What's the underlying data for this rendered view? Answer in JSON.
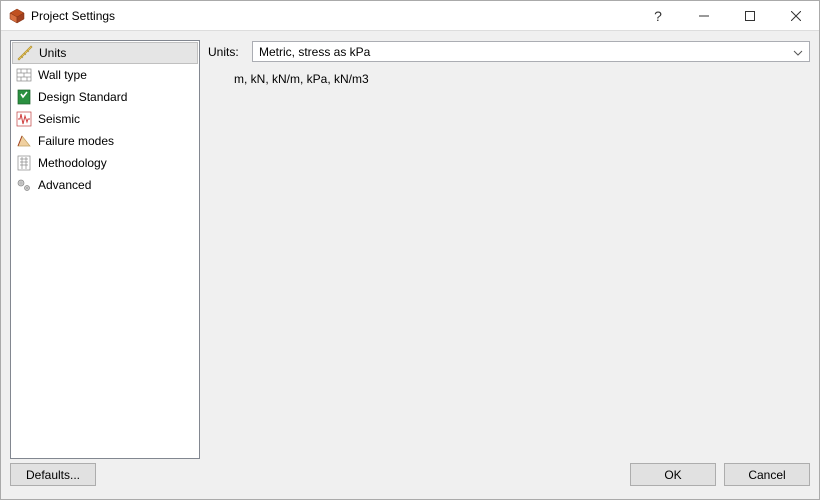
{
  "window": {
    "title": "Project Settings"
  },
  "sidebar": {
    "items": [
      {
        "label": "Units"
      },
      {
        "label": "Wall type"
      },
      {
        "label": "Design Standard"
      },
      {
        "label": "Seismic"
      },
      {
        "label": "Failure modes"
      },
      {
        "label": "Methodology"
      },
      {
        "label": "Advanced"
      }
    ],
    "selected_index": 0
  },
  "content": {
    "units_label": "Units:",
    "units_selected": "Metric, stress as kPa",
    "units_description": "m, kN, kN/m, kPa, kN/m3"
  },
  "buttons": {
    "defaults": "Defaults...",
    "ok": "OK",
    "cancel": "Cancel"
  }
}
